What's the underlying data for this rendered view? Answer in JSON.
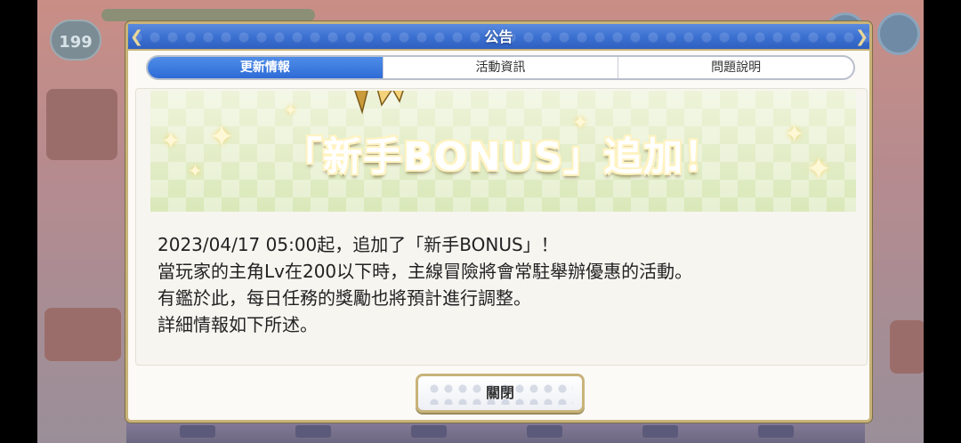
{
  "background": {
    "player_level": "199"
  },
  "dialog": {
    "title": "公告",
    "tabs": [
      {
        "label": "更新情報",
        "active": true
      },
      {
        "label": "活動資訊",
        "active": false
      },
      {
        "label": "問題說明",
        "active": false
      }
    ],
    "banner_text": "「新手BONUS」追加！",
    "notice_lines": [
      "2023/04/17 05:00起，追加了「新手BONUS」！",
      "當玩家的主角Lv在200以下時，主線冒險將會常駐舉辦優惠的活動。",
      "有鑑於此，每日任務的獎勵也將預計進行調整。",
      "詳細情報如下所述。"
    ],
    "close_label": "關閉"
  },
  "colors": {
    "header_blue": "#3a6fd0",
    "active_tab": "#2e6bd6",
    "gold_border": "#c8b37a",
    "banner_text": "#e29a18"
  }
}
